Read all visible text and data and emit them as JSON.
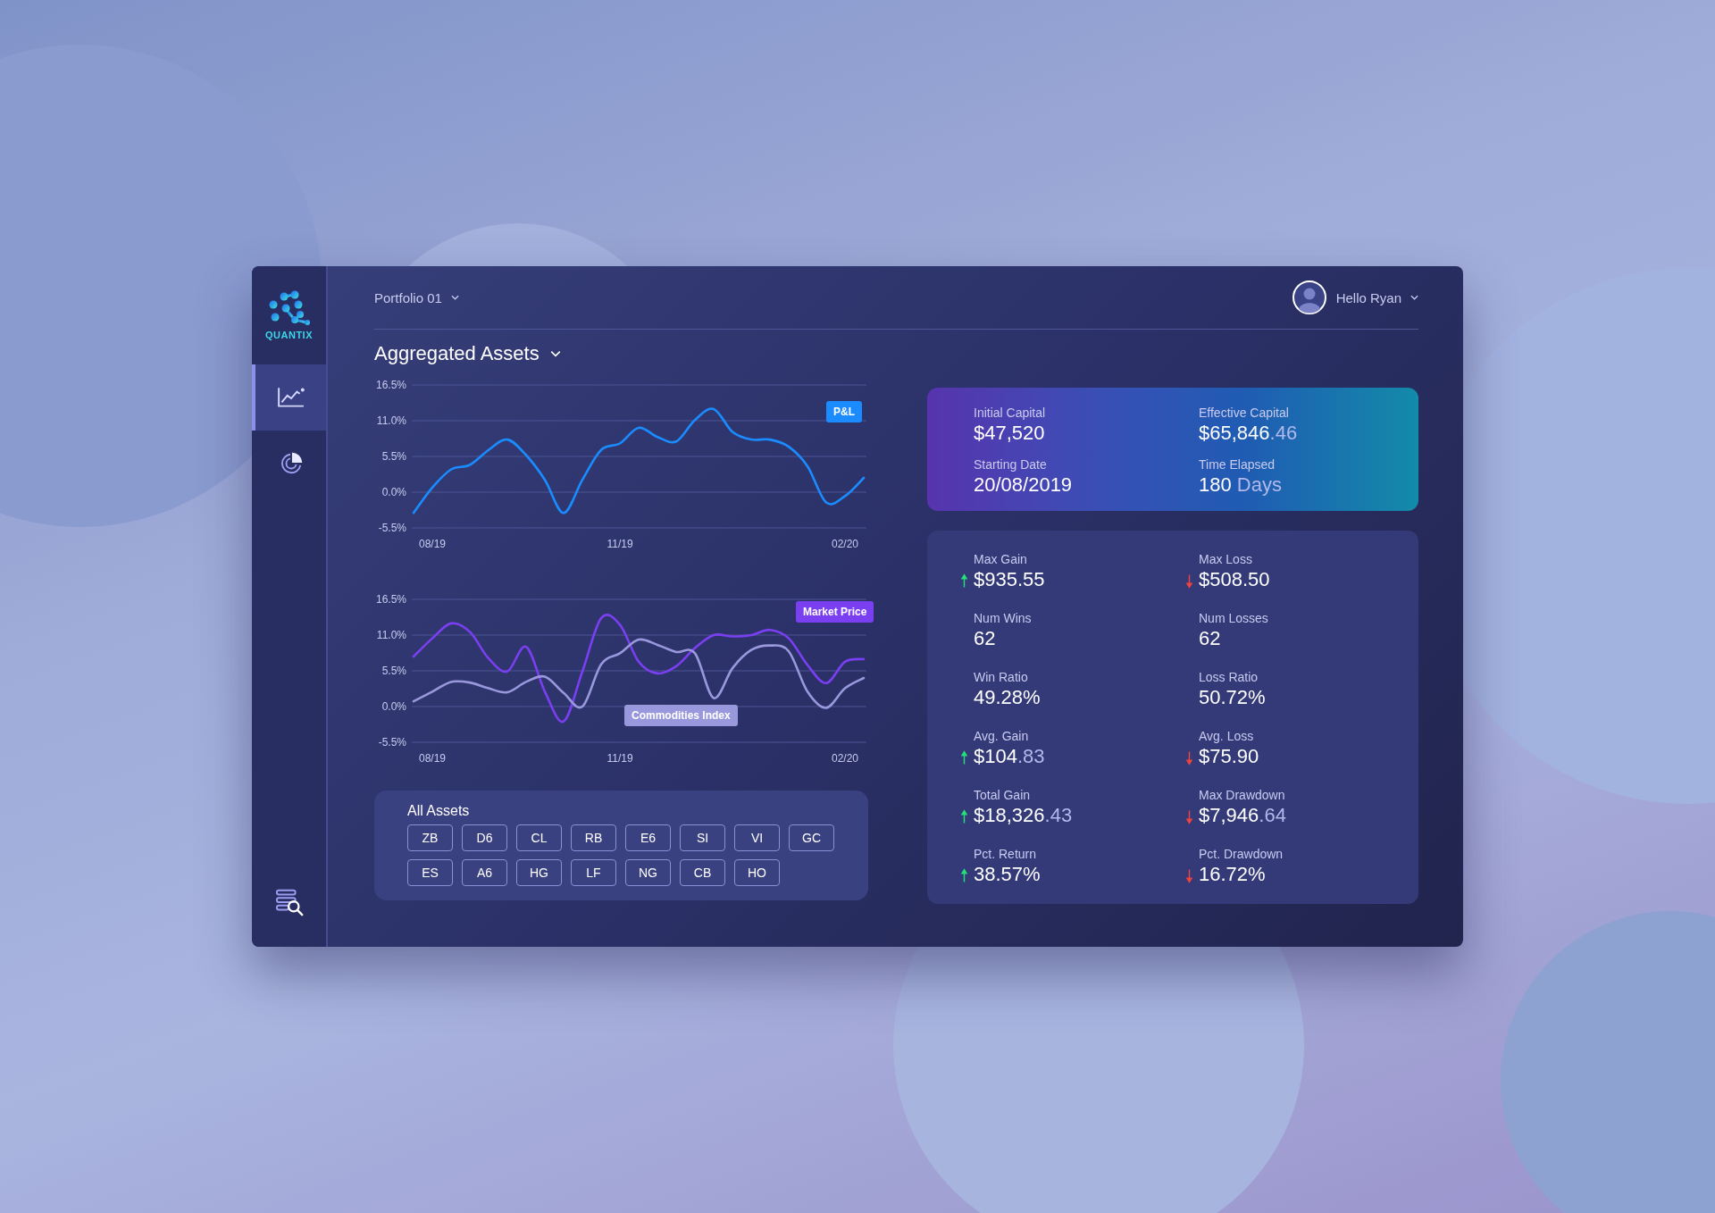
{
  "sidebar": {
    "logo": "QUANTIX",
    "nav": [
      {
        "kind": "chart",
        "selected": true
      },
      {
        "kind": "pie",
        "selected": false
      }
    ]
  },
  "header": {
    "portfolio": "Portfolio 01",
    "user": "Hello Ryan"
  },
  "title": "Aggregated Assets",
  "charts": [
    {
      "chart_data": {
        "type": "line",
        "grid": true,
        "categories": [
          null,
          "08/19",
          null,
          null,
          null,
          null,
          null,
          null,
          null,
          null,
          null,
          "11/19",
          null,
          null,
          null,
          null,
          null,
          null,
          null,
          null,
          null,
          null,
          null,
          "02/20",
          null
        ],
        "ylim": [
          -5.5,
          16.5
        ],
        "yticks": [
          {
            "value": 16.5,
            "label": "16.5%"
          },
          {
            "value": 11,
            "label": "11.0%"
          },
          {
            "value": 5.5,
            "label": "5.5%"
          },
          {
            "value": 0,
            "label": "0.0%"
          },
          {
            "value": -5.5,
            "label": "-5.5%"
          }
        ],
        "series": [
          {
            "name": "P&L",
            "color": "#1a8cff",
            "values": [
              -3.2,
              0.7,
              3.5,
              4.2,
              6.5,
              8.1,
              5.7,
              1.9,
              -3.2,
              1.9,
              6.5,
              7.5,
              9.9,
              8.5,
              7.8,
              11.1,
              12.8,
              9.3,
              8.1,
              8.1,
              7.0,
              4.0,
              -1.6,
              -0.6,
              2.2
            ]
          }
        ]
      }
    },
    {
      "chart_data": {
        "type": "line",
        "grid": true,
        "categories": [
          null,
          "08/19",
          null,
          null,
          null,
          null,
          null,
          null,
          null,
          null,
          null,
          "11/19",
          null,
          null,
          null,
          null,
          null,
          null,
          null,
          null,
          null,
          null,
          null,
          "02/20",
          null
        ],
        "ylim": [
          -5.5,
          16.5
        ],
        "yticks": [
          {
            "value": 16.5,
            "label": "16.5%"
          },
          {
            "value": 11,
            "label": "11.0%"
          },
          {
            "value": 5.5,
            "label": "5.5%"
          },
          {
            "value": 0,
            "label": "0.0%"
          },
          {
            "value": -5.5,
            "label": "-5.5%"
          }
        ],
        "series": [
          {
            "name": "Market Price",
            "color": "#7b3ff2",
            "values": [
              7.7,
              10.5,
              12.8,
              11.5,
              7.4,
              5.4,
              9.2,
              2.3,
              -2.3,
              5.4,
              13.6,
              12.6,
              6.9,
              5.1,
              6.2,
              9.0,
              11.0,
              10.8,
              11.0,
              11.8,
              10.5,
              6.4,
              3.6,
              6.9,
              7.3
            ]
          },
          {
            "name": "Commodities Index",
            "color": "#9a98dc",
            "values": [
              0.8,
              2.3,
              3.8,
              3.7,
              2.8,
              2.2,
              3.8,
              4.6,
              2.1,
              0.0,
              6.5,
              8.2,
              10.3,
              9.5,
              8.4,
              8.2,
              1.3,
              5.9,
              8.7,
              9.4,
              8.5,
              2.3,
              -0.2,
              2.8,
              4.4
            ]
          }
        ]
      }
    }
  ],
  "assets": {
    "title": "All Assets",
    "items": [
      "ZB",
      "D6",
      "CL",
      "RB",
      "E6",
      "SI",
      "VI",
      "GC",
      "ES",
      "A6",
      "HG",
      "LF",
      "NG",
      "CB",
      "HO"
    ]
  },
  "summary": [
    {
      "label": "Initial Capital",
      "value": "$47,520"
    },
    {
      "label": "Effective Capital",
      "value": "$65,846",
      "minor": ".46"
    },
    {
      "label": "Starting Date",
      "value": "20/08/2019"
    },
    {
      "label": "Time Elapsed",
      "value": "180",
      "minor": " Days"
    }
  ],
  "stats": [
    {
      "kind": "up",
      "label": "Max Gain",
      "value": "$935.55"
    },
    {
      "kind": "down",
      "label": "Max Loss",
      "value": "$508.50"
    },
    {
      "kind": "plain",
      "label": "Num Wins",
      "value": "62"
    },
    {
      "kind": "plain",
      "label": "Num Losses",
      "value": "62"
    },
    {
      "kind": "plain",
      "label": "Win Ratio",
      "value": "49.28%"
    },
    {
      "kind": "plain",
      "label": "Loss Ratio",
      "value": "50.72%"
    },
    {
      "kind": "up",
      "label": "Avg. Gain",
      "value": "$104",
      "minor": ".83"
    },
    {
      "kind": "down",
      "label": "Avg. Loss",
      "value": "$75.90"
    },
    {
      "kind": "up",
      "label": "Total Gain",
      "value": "$18,326",
      "minor": ".43"
    },
    {
      "kind": "down",
      "label": "Max Drawdown",
      "value": "$7,946",
      "minor": ".64"
    },
    {
      "kind": "up",
      "label": "Pct. Return",
      "value": "38.57%"
    },
    {
      "kind": "down",
      "label": "Pct. Drawdown",
      "value": "16.72%"
    }
  ]
}
